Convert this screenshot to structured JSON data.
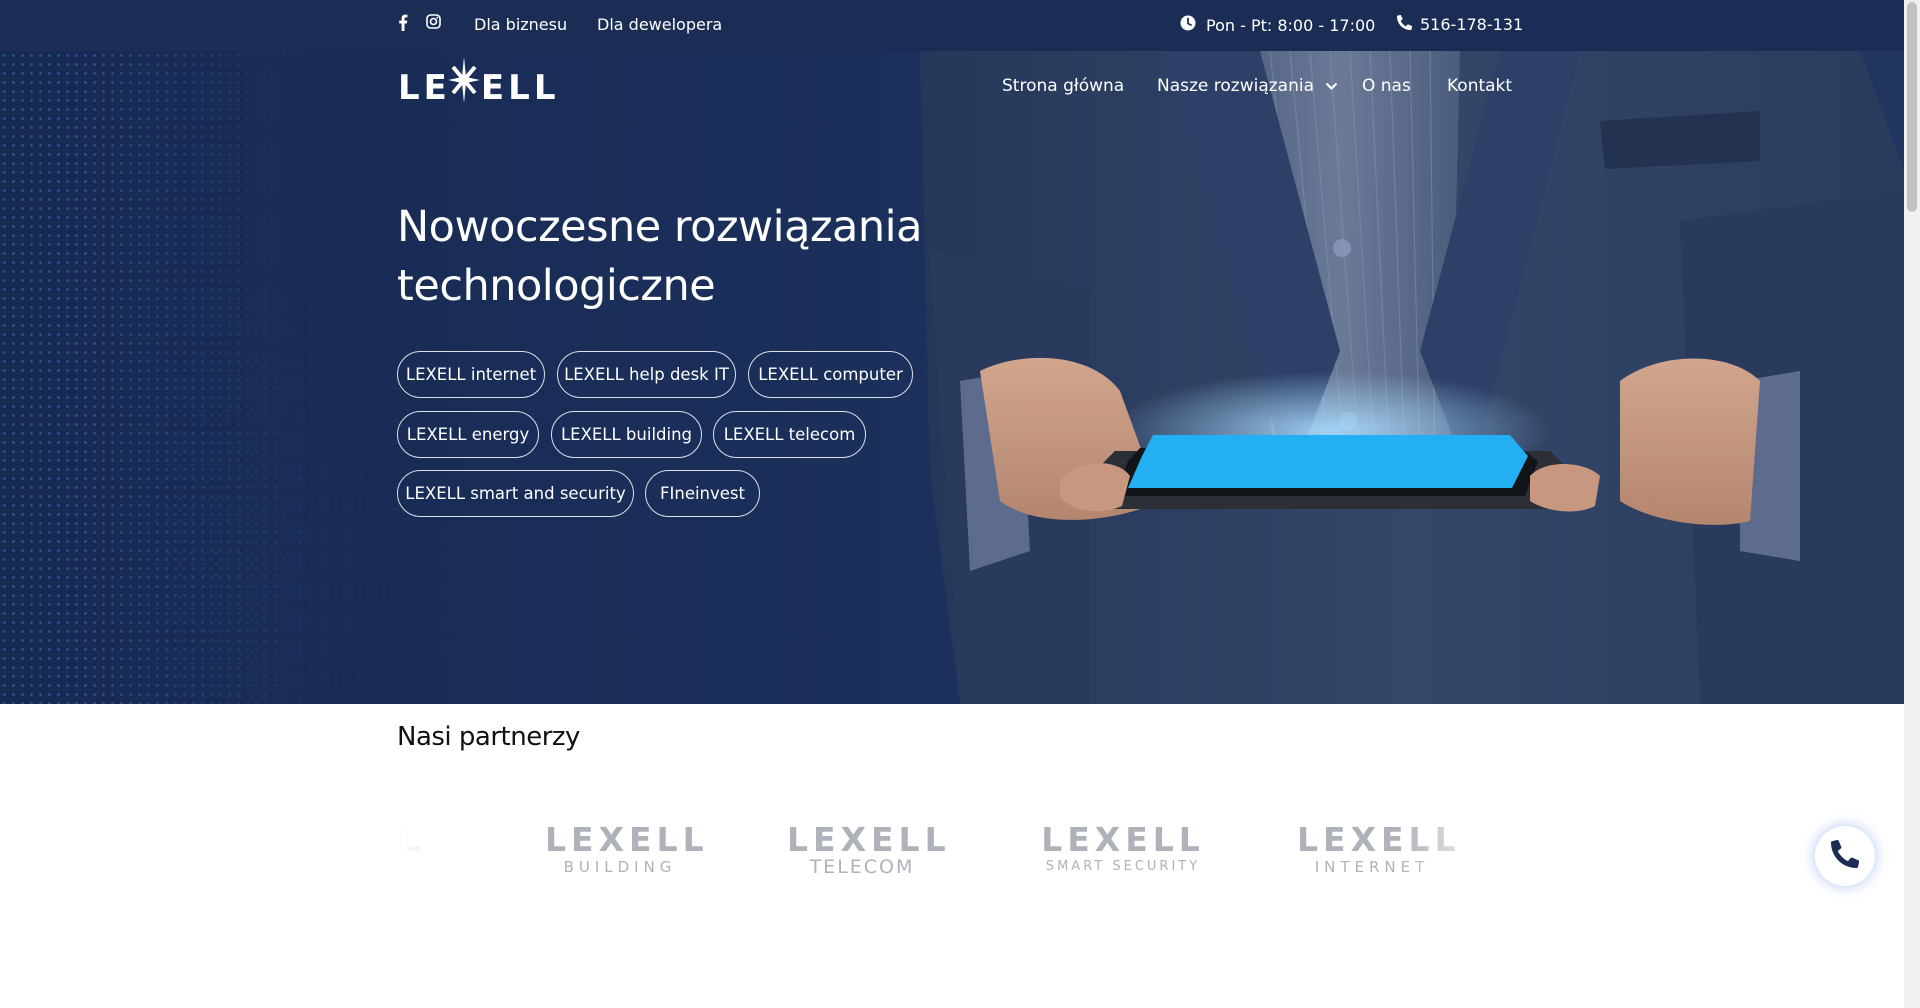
{
  "topbar": {
    "social": [
      "facebook-icon",
      "instagram-icon"
    ],
    "links": [
      "Dla biznesu",
      "Dla dewelopera"
    ],
    "hours": "Pon - Pt: 8:00 - 17:00",
    "phone": "516-178-131"
  },
  "header": {
    "logo": "LEXELL",
    "nav": [
      "Strona główna",
      "Nasze rozwiązania",
      "O nas",
      "Kontakt"
    ]
  },
  "hero": {
    "headline_line1": "Nowoczesne rozwiązania",
    "headline_line2": "technologiczne",
    "solutions": [
      "LEXELL internet",
      "LEXELL help desk IT",
      "LEXELL computer",
      "LEXELL energy",
      "LEXELL building",
      "LEXELL telecom",
      "LEXELL smart and security",
      "FIneinvest"
    ]
  },
  "partners": {
    "title": "Nasi partnerzy",
    "logos": [
      {
        "main": "LEXELL",
        "sub": "BUILDING"
      },
      {
        "main": "LEXELL",
        "sub": "TELECOM"
      },
      {
        "main": "LEXELL",
        "sub": "SMART SECURITY"
      },
      {
        "main": "LEXELL",
        "sub": "INTERNET"
      }
    ]
  },
  "colors": {
    "navy": "#1b2d55",
    "accent_blue": "#1ea7f0",
    "partner_gray": "#aeb2ba"
  }
}
